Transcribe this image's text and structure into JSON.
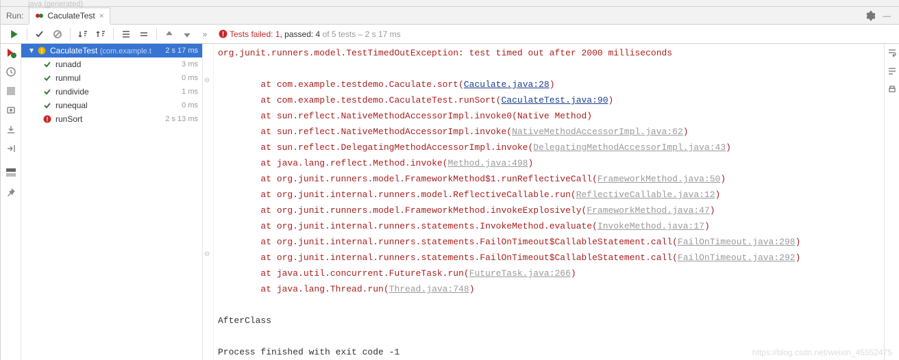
{
  "breadcrumb_hint": "java (generated)",
  "run_label": "Run:",
  "tab": {
    "title": "CaculateTest"
  },
  "gear_icon": "gear",
  "status": {
    "prefix": "Tests failed: ",
    "failed": "1",
    "passed_prefix": ", passed: ",
    "passed": "4",
    "of": " of 5 tests",
    "dur": " – 2 s 17 ms"
  },
  "tree": {
    "root": {
      "name": "CaculateTest",
      "pkg": "(com.example.t",
      "dur": "2 s 17 ms",
      "status": "fail"
    },
    "items": [
      {
        "name": "runadd",
        "dur": "3 ms",
        "status": "pass"
      },
      {
        "name": "runmul",
        "dur": "0 ms",
        "status": "pass"
      },
      {
        "name": "rundivide",
        "dur": "1 ms",
        "status": "pass"
      },
      {
        "name": "runequal",
        "dur": "0 ms",
        "status": "pass"
      },
      {
        "name": "runSort",
        "dur": "2 s 13 ms",
        "status": "fail"
      }
    ]
  },
  "console": {
    "exception": "org.junit.runners.model.TestTimedOutException: test timed out after 2000 milliseconds",
    "blank": "",
    "lines": [
      {
        "pre": "\tat com.example.testdemo.Caculate.sort(",
        "link": "Caculate.java:28",
        "cls": "link",
        "post": ")"
      },
      {
        "pre": "\tat com.example.testdemo.CaculateTest.runSort(",
        "link": "CaculateTest.java:90",
        "cls": "link",
        "post": ")"
      },
      {
        "pre": "\tat sun.reflect.NativeMethodAccessorImpl.invoke0(Native Method)",
        "link": "",
        "cls": "",
        "post": ""
      },
      {
        "pre": "\tat sun.reflect.NativeMethodAccessorImpl.invoke(",
        "link": "NativeMethodAccessorImpl.java:62",
        "cls": "glink",
        "post": ")"
      },
      {
        "pre": "\tat sun.reflect.DelegatingMethodAccessorImpl.invoke(",
        "link": "DelegatingMethodAccessorImpl.java:43",
        "cls": "glink",
        "post": ")"
      },
      {
        "pre": "\tat java.lang.reflect.Method.invoke(",
        "link": "Method.java:498",
        "cls": "glink",
        "post": ")"
      },
      {
        "pre": "\tat org.junit.runners.model.FrameworkMethod$1.runReflectiveCall(",
        "link": "FrameworkMethod.java:50",
        "cls": "glink",
        "post": ")"
      },
      {
        "pre": "\tat org.junit.internal.runners.model.ReflectiveCallable.run(",
        "link": "ReflectiveCallable.java:12",
        "cls": "glink",
        "post": ")"
      },
      {
        "pre": "\tat org.junit.runners.model.FrameworkMethod.invokeExplosively(",
        "link": "FrameworkMethod.java:47",
        "cls": "glink",
        "post": ")"
      },
      {
        "pre": "\tat org.junit.internal.runners.statements.InvokeMethod.evaluate(",
        "link": "InvokeMethod.java:17",
        "cls": "glink",
        "post": ")"
      },
      {
        "pre": "\tat org.junit.internal.runners.statements.FailOnTimeout$CallableStatement.call(",
        "link": "FailOnTimeout.java:298",
        "cls": "glink",
        "post": ")"
      },
      {
        "pre": "\tat org.junit.internal.runners.statements.FailOnTimeout$CallableStatement.call(",
        "link": "FailOnTimeout.java:292",
        "cls": "glink",
        "post": ")"
      },
      {
        "pre": "\tat java.util.concurrent.FutureTask.run(",
        "link": "FutureTask.java:266",
        "cls": "glink",
        "post": ")"
      },
      {
        "pre": "\tat java.lang.Thread.run(",
        "link": "Thread.java:748",
        "cls": "glink",
        "post": ")"
      }
    ],
    "afterclass": "AfterClass",
    "exit": "Process finished with exit code -1"
  },
  "watermark": "https://blog.csdn.net/weixin_45552475"
}
